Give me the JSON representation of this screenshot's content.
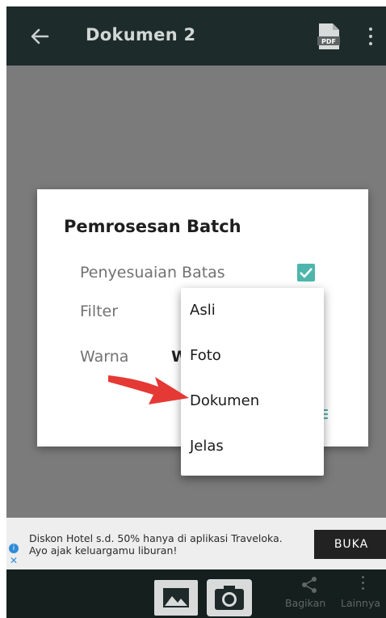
{
  "header": {
    "title": "Dokumen 2",
    "pdf_label": "PDF"
  },
  "dialog": {
    "title": "Pemrosesan Batch",
    "border_adjust_label": "Penyesuaian Batas",
    "border_adjust_checked": true,
    "filter_label": "Filter",
    "color_label": "Warna",
    "color_value": "W"
  },
  "dropdown": {
    "options": [
      "Asli",
      "Foto",
      "Dokumen",
      "Jelas"
    ]
  },
  "ad": {
    "text": "Diskon Hotel s.d. 50% hanya di aplikasi Traveloka. Ayo ajak keluargamu liburan!",
    "button": "BUKA",
    "info_glyph": "i",
    "close_glyph": "✕"
  },
  "bottom": {
    "share_label": "Bagikan",
    "more_label": "Lainnya"
  },
  "colors": {
    "topbar": "#1d2b2a",
    "accent": "#4db6ac",
    "overlay": "#7b7b7b",
    "arrow": "#e53935"
  }
}
